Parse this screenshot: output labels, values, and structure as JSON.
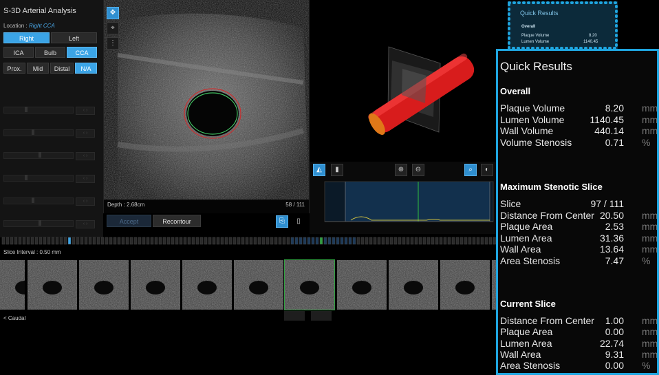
{
  "app": {
    "title": "S-3D Arterial Analysis"
  },
  "location": {
    "label": "Location :",
    "value": "Right CCA"
  },
  "side_buttons": [
    {
      "label": "Right",
      "selected": true
    },
    {
      "label": "Left",
      "selected": false
    }
  ],
  "segment_buttons": [
    {
      "label": "ICA",
      "selected": false
    },
    {
      "label": "Bulb",
      "selected": false
    },
    {
      "label": "CCA",
      "selected": true
    }
  ],
  "position_buttons": [
    {
      "label": "Prox.",
      "selected": false
    },
    {
      "label": "Mid",
      "selected": false
    },
    {
      "label": "Distal",
      "selected": false
    },
    {
      "label": "N/A",
      "selected": true
    }
  ],
  "ultrasound": {
    "depth": "Depth : 2.68cm",
    "slice": "58 / 111"
  },
  "recontour_buttons": [
    "Accept",
    "Recontour"
  ],
  "timeline": {
    "interval": "Slice Interval : 0.50 mm",
    "caudal": "< Caudal"
  },
  "quick_results": {
    "title": "Quick Results",
    "overall": {
      "heading": "Overall",
      "rows": [
        {
          "label": "Plaque Volume",
          "value": "8.20",
          "unit": "mm"
        },
        {
          "label": "Lumen Volume",
          "value": "1140.45",
          "unit": "mm"
        },
        {
          "label": "Wall Volume",
          "value": "440.14",
          "unit": "mm"
        },
        {
          "label": "Volume Stenosis",
          "value": "0.71",
          "unit": "%"
        }
      ]
    },
    "max_stenotic": {
      "heading": "Maximum Stenotic Slice",
      "rows": [
        {
          "label": "Slice",
          "value": "97 / 111",
          "unit": ""
        },
        {
          "label": "Distance From Center",
          "value": "20.50",
          "unit": "mm"
        },
        {
          "label": "Plaque Area",
          "value": "2.53",
          "unit": "mm"
        },
        {
          "label": "Lumen Area",
          "value": "31.36",
          "unit": "mm"
        },
        {
          "label": "Wall Area",
          "value": "13.64",
          "unit": "mm"
        },
        {
          "label": "Area Stenosis",
          "value": "7.47",
          "unit": "%"
        }
      ]
    },
    "current": {
      "heading": "Current Slice",
      "rows": [
        {
          "label": "Distance From Center",
          "value": "1.00",
          "unit": "mm"
        },
        {
          "label": "Plaque Area",
          "value": "0.00",
          "unit": "mm"
        },
        {
          "label": "Lumen Area",
          "value": "22.74",
          "unit": "mm"
        },
        {
          "label": "Wall Area",
          "value": "9.31",
          "unit": "mm"
        },
        {
          "label": "Area Stenosis",
          "value": "0.00",
          "unit": "%"
        }
      ]
    }
  },
  "quick_results_preview": {
    "title": "Quick Results",
    "heading": "Overall",
    "rows": [
      {
        "label": "Plaque Volume",
        "value": "8.20"
      },
      {
        "label": "Lumen Volume",
        "value": "1140.45"
      }
    ]
  },
  "colors": {
    "accent": "#1fa6e0",
    "selected": "#3ba4e6",
    "vessel": "#e02020"
  }
}
